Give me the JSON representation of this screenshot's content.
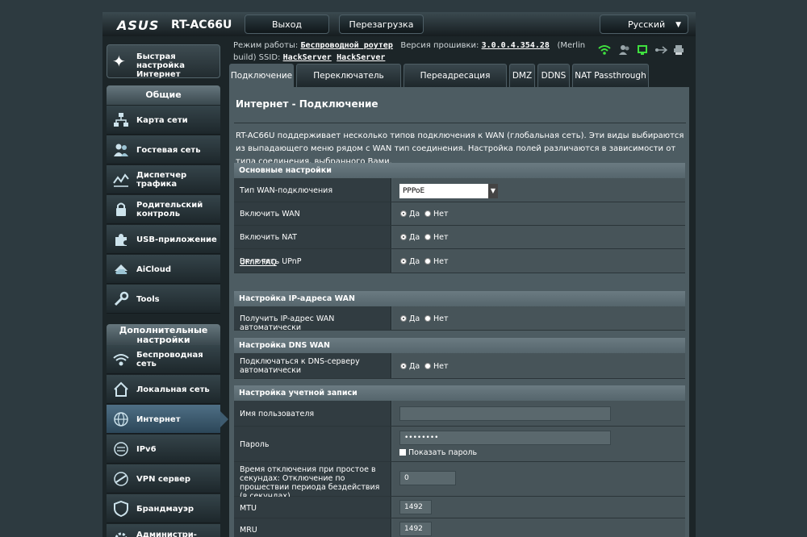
{
  "header": {
    "brand": "ASUS",
    "model": "RT-AC66U",
    "logout": "Выход",
    "reboot": "Перезагрузка",
    "language": "Русский"
  },
  "info": {
    "mode_label": "Режим работы:",
    "mode_value": "Беспроводной роутер",
    "fw_label": "Версия прошивки:",
    "fw_value": "3.0.0.4.354.28",
    "fw_suffix": "(Merlin",
    "build": "build) SSID:",
    "ssid1": "HackServer",
    "ssid2": "HackServer"
  },
  "status_icons": [
    "wifi-icon",
    "users-icon",
    "network-icon",
    "usb-icon",
    "printer-icon"
  ],
  "sidebar": {
    "quick_setup": "Быстрая настройка Интернет",
    "general_header": "Общие",
    "general": [
      {
        "label": "Карта сети",
        "icon": "network-map-icon"
      },
      {
        "label": "Гостевая сеть",
        "icon": "guest-network-icon"
      },
      {
        "label": "Диспетчер трафика",
        "icon": "traffic-manager-icon"
      },
      {
        "label": "Родительский контроль",
        "icon": "parental-control-icon"
      },
      {
        "label": "USB-приложение",
        "icon": "usb-app-icon"
      },
      {
        "label": "AiCloud",
        "icon": "cloud-icon"
      },
      {
        "label": "Tools",
        "icon": "tools-icon"
      }
    ],
    "advanced_header": "Дополнительные настройки",
    "advanced": [
      {
        "label": "Беспроводная сеть",
        "icon": "wireless-icon"
      },
      {
        "label": "Локальная сеть",
        "icon": "lan-icon"
      },
      {
        "label": "Интернет",
        "icon": "internet-icon"
      },
      {
        "label": "IPv6",
        "icon": "ipv6-icon"
      },
      {
        "label": "VPN сервер",
        "icon": "vpn-icon"
      },
      {
        "label": "Брандмауэр",
        "icon": "firewall-icon"
      },
      {
        "label": "Администри-",
        "icon": "admin-icon"
      }
    ],
    "active": "Интернет"
  },
  "tabs": [
    "Подключение",
    "Переключатель портов",
    "Переадресация портов",
    "DMZ",
    "DDNS",
    "NAT Passthrough"
  ],
  "panel": {
    "title": "Интернет - Подключение",
    "description": "RT-AC66U поддерживает несколько типов подключения к WAN (глобальная сеть). Эти виды выбираются из выпадающего меню рядом с WAN тип соединения. Настройка полей различаются в зависимости от типа соединения, выбранного Вами.",
    "yes": "Да",
    "no": "Нет",
    "sections": {
      "basic": "Основные настройки",
      "wan_ip": "Настройка IP-адреса WAN",
      "wan_dns": "Настройка DNS WAN",
      "account": "Настройка учетной записи"
    },
    "fields": {
      "wan_type_label": "Тип WAN-подключения",
      "wan_type_value": "PPPoE",
      "enable_wan": "Включить WAN",
      "enable_nat": "Включить NAT",
      "enable_upnp": "Включить UPnP",
      "upnp_faq": "UPnP FAQ",
      "auto_ip": "Получить IP-адрес WAN автоматически",
      "auto_dns": "Подключаться к DNS-серверу автоматически",
      "username_label": "Имя пользователя",
      "username_value": "",
      "password_label": "Пароль",
      "password_value": "••••••••",
      "show_password": "Показать пароль",
      "idle_label": "Время отключения при простое в секундах: Отключение по прошествии периода бездействия (в секундах)",
      "idle_value": "0",
      "mtu_label": "MTU",
      "mtu_value": "1492",
      "mru_label": "MRU",
      "mru_value": "1492"
    }
  }
}
